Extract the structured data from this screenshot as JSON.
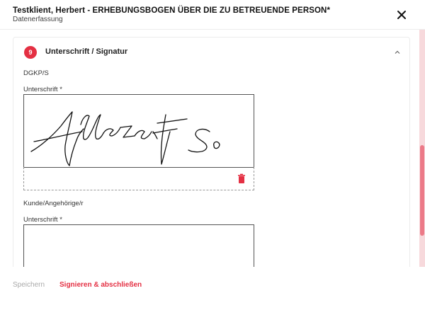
{
  "dialog": {
    "title": "Testklient, Herbert - ERHEBUNGSBOGEN ÜBER DIE ZU BETREUENDE PERSON*",
    "subtitle": "Datenerfassung",
    "close_icon": "close-icon"
  },
  "section": {
    "number": "9",
    "title": "Unterschrift / Signatur",
    "expanded": true
  },
  "signatures": [
    {
      "role": "DGKP/S",
      "label": "Unterschrift *",
      "signed": true
    },
    {
      "role": "Kunde/Angehörige/r",
      "label": "Unterschrift *",
      "signed": false
    }
  ],
  "footer": {
    "save_label": "Speichern",
    "sign_label": "Signieren & abschließen"
  },
  "colors": {
    "accent": "#e43043",
    "muted": "#a9a9a9",
    "scroll_track": "#f7d9dc",
    "scroll_thumb": "#ec7a88"
  },
  "icons": {
    "close": "close-icon",
    "collapse": "chevron-up-icon",
    "delete": "trash-icon"
  }
}
